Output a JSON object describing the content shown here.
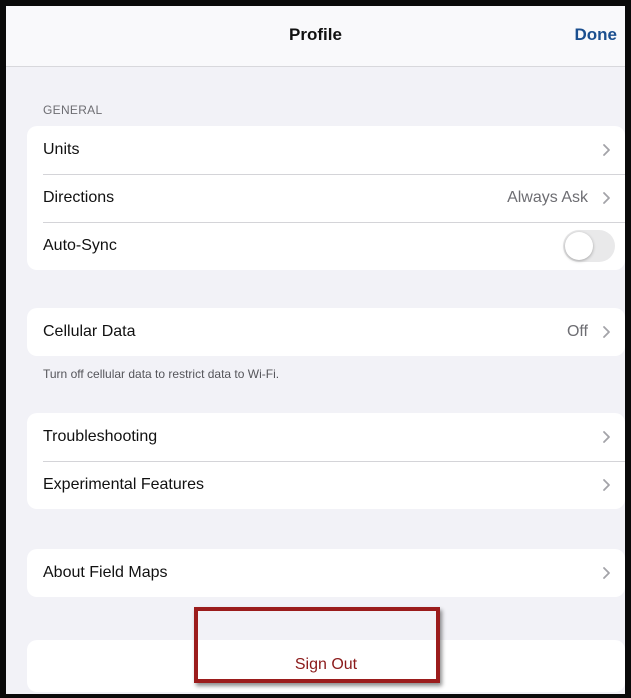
{
  "navbar": {
    "title": "Profile",
    "done_label": "Done"
  },
  "general": {
    "header": "GENERAL",
    "rows": [
      {
        "label": "Units",
        "value": ""
      },
      {
        "label": "Directions",
        "value": "Always Ask"
      },
      {
        "label": "Auto-Sync",
        "toggle_on": false
      }
    ]
  },
  "cellular": {
    "label": "Cellular Data",
    "value": "Off",
    "footnote": "Turn off cellular data to restrict data to Wi-Fi."
  },
  "support": {
    "rows": [
      {
        "label": "Troubleshooting"
      },
      {
        "label": "Experimental Features"
      }
    ]
  },
  "about": {
    "label": "About Field Maps"
  },
  "signout": {
    "label": "Sign Out"
  },
  "colors": {
    "accent": "#1b4f8f",
    "destructive": "#8b1a1a",
    "highlight": "#9b1c1c",
    "background": "#f2f2f7"
  },
  "icons": {
    "chevron": "chevron-right-icon"
  }
}
